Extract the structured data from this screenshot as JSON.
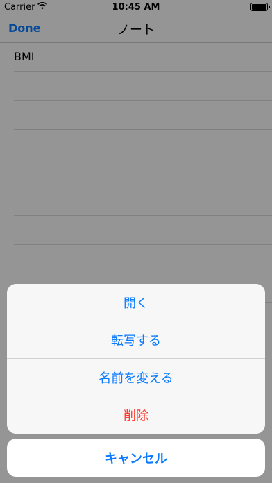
{
  "status_bar": {
    "carrier": "Carrier",
    "time": "10:45 AM",
    "wifi_icon": "wifi-icon",
    "battery_icon": "battery-icon"
  },
  "nav": {
    "done_label": "Done",
    "title": "ノート"
  },
  "notes": [
    {
      "title": "BMI"
    },
    {
      "title": ""
    },
    {
      "title": ""
    },
    {
      "title": ""
    },
    {
      "title": ""
    },
    {
      "title": ""
    },
    {
      "title": ""
    },
    {
      "title": ""
    },
    {
      "title": ""
    }
  ],
  "action_sheet": {
    "open_label": "開く",
    "transcribe_label": "転写する",
    "rename_label": "名前を変える",
    "delete_label": "削除",
    "cancel_label": "キャンセル"
  },
  "colors": {
    "accent": "#0a7aff",
    "destructive": "#ff3b30"
  }
}
